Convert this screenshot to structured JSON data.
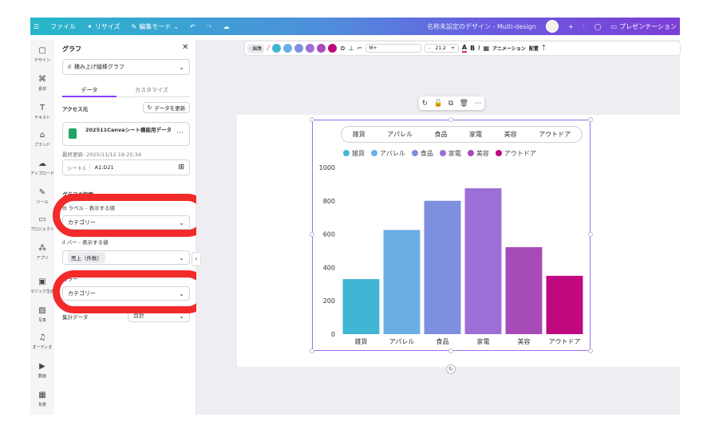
{
  "topbar": {
    "menu_icon": "hamburger-icon",
    "file_label": "ファイル",
    "resize_label": "リサイズ",
    "edit_mode_label": "編集モード",
    "doc_title": "名称未設定のデザイン - Multi-design",
    "add_label": "+",
    "present_label": "プレゼンテーション"
  },
  "rail": [
    {
      "label": "デザイン",
      "icon": "layout-icon"
    },
    {
      "label": "素材",
      "icon": "elements-icon"
    },
    {
      "label": "テキスト",
      "icon": "text-icon"
    },
    {
      "label": "ブランド",
      "icon": "brand-icon"
    },
    {
      "label": "アップロード",
      "icon": "upload-icon"
    },
    {
      "label": "ツール",
      "icon": "draw-icon"
    },
    {
      "label": "プロジェクト",
      "icon": "folder-icon"
    },
    {
      "label": "アプリ",
      "icon": "apps-icon"
    },
    {
      "label": "マジック生成",
      "icon": "magic-media-icon"
    },
    {
      "label": "写真",
      "icon": "photo-icon"
    },
    {
      "label": "オーディオ",
      "icon": "audio-icon"
    },
    {
      "label": "動画",
      "icon": "video-icon"
    },
    {
      "label": "背景",
      "icon": "background-icon"
    }
  ],
  "panel": {
    "title": "グラフ",
    "chart_type": "積み上げ縦棒グラフ",
    "tab_data": "データ",
    "tab_customize": "カスタマイズ",
    "access_label": "アクセス元",
    "refresh_label": "データを更新",
    "source_name": "202511Canvaシート機能用データ",
    "last_updated": "最終更新: 2025/11/12 19:25:34",
    "sheet_name": "シート1",
    "range": "A1:D21",
    "settings_label": "グラフの設定",
    "label_field_title": "ラベル - 表示する値",
    "label_value": "カテゴリー",
    "bar_field_title": "バー - 表示する値",
    "bar_value": "売上（件数）",
    "color_title": "カラー",
    "color_value": "カテゴリー",
    "aggregate_label": "集計データ",
    "aggregate_value": "合計"
  },
  "toolbar": {
    "edit_label": "編集",
    "font_name": "M+",
    "font_size": "21.2",
    "minus": "-",
    "plus": "+",
    "bold": "B",
    "italic": "I",
    "animation_label": "アニメーション",
    "position_label": "配置",
    "swatches": [
      "#e0245e",
      "#41b6d4",
      "#6aaee6",
      "#7f8fe0",
      "#9b6fd6",
      "#a64bb8",
      "#c0087f"
    ]
  },
  "chart_tabs": [
    "雑貨",
    "アパレル",
    "食品",
    "家電",
    "美容",
    "アウトドア"
  ],
  "chart_data": {
    "type": "bar",
    "categories": [
      "雑貨",
      "アパレル",
      "食品",
      "家電",
      "美容",
      "アウトドア"
    ],
    "values": [
      330,
      625,
      800,
      875,
      522,
      350
    ],
    "colors": [
      "#41b6d4",
      "#6aaee6",
      "#7f8fe0",
      "#9b6fd6",
      "#a64bb8",
      "#c0087f"
    ],
    "ylim": [
      0,
      1000
    ],
    "yticks": [
      0,
      200,
      400,
      600,
      800,
      1000
    ],
    "legend": [
      "雑貨",
      "アパレル",
      "食品",
      "家電",
      "美容",
      "アウトドア"
    ],
    "legend_position": "top",
    "grid": false
  }
}
